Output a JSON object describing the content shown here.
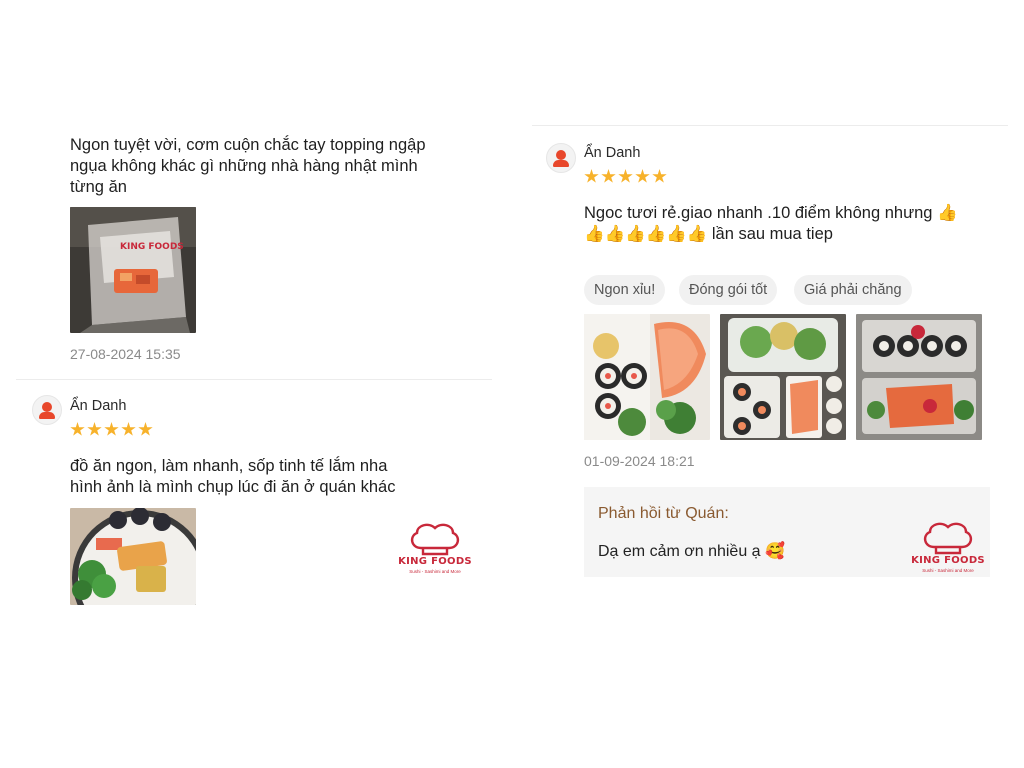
{
  "reviews_left": {
    "top_review": {
      "text": "Ngon tuyệt vời, cơm cuộn chắc tay topping ngập\nngụa không khác gì những nhà hàng nhật mình\ntừng ăn",
      "date": "27-08-2024 15:35"
    },
    "second_review": {
      "user": "Ẩn Danh",
      "rating": 5,
      "text": "đồ ăn ngon, làm nhanh, sốp tinh tế lắm nha\nhình ảnh là mình chụp lúc đi ăn ở quán khác"
    }
  },
  "reviews_right": {
    "review": {
      "user": "Ẩn Danh",
      "rating": 5,
      "text": "Ngoc tươi rẻ.giao nhanh .10 điểm không nhưng 👍\n👍👍👍👍👍👍 lần sau mua tiep",
      "tags": [
        "Ngon xỉu!",
        "Đóng gói tốt",
        "Giá phải chăng"
      ],
      "date": "01-09-2024 18:21"
    },
    "reply": {
      "title": "Phản hồi từ Quán:",
      "text": "Dạ em cảm ơn nhiều ạ 🥰"
    }
  },
  "brand": {
    "name": "KING FOODS",
    "tagline": "Sushi - Sashimi and More",
    "color": "#c8283a"
  },
  "colors": {
    "star": "#f7b22b",
    "avatar": "#e8472b",
    "reply_title": "#8a5a30"
  }
}
